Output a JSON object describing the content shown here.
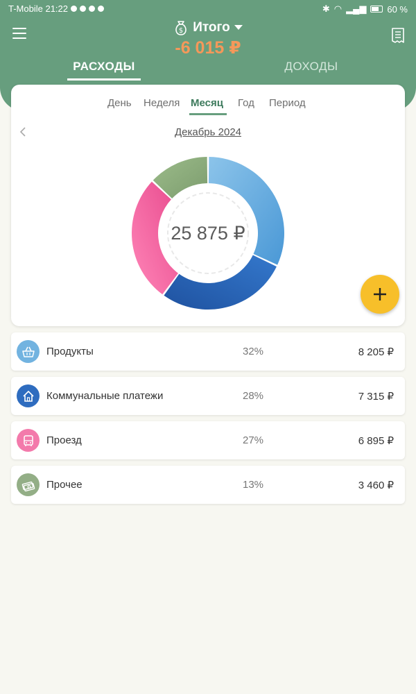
{
  "status": {
    "carrier_time": "T-Mobile 21:22",
    "battery": "60 %"
  },
  "header": {
    "title": "Итого",
    "total": "-6 015 ₽",
    "tabs": [
      {
        "label": "РАСХОДЫ",
        "active": true
      },
      {
        "label": "ДОХОДЫ",
        "active": false
      }
    ]
  },
  "period": {
    "tabs": [
      "День",
      "Неделя",
      "Месяц",
      "Год",
      "Период"
    ],
    "active": "Месяц",
    "label": "Декабрь 2024"
  },
  "donut": {
    "total": "25 875 ₽"
  },
  "chart_data": {
    "type": "pie",
    "categories": [
      "Продукты",
      "Коммунальные платежи",
      "Проезд",
      "Прочее"
    ],
    "values": [
      32,
      28,
      27,
      13
    ],
    "colors": [
      "#5aa6dc",
      "#2a66b8",
      "#f0609a",
      "#8aab7a"
    ]
  },
  "categories": [
    {
      "name": "Продукты",
      "pct": "32%",
      "amount": "8 205 ₽",
      "icon": "grocery-basket-icon",
      "color": "#72b3e0"
    },
    {
      "name": "Коммунальные платежи",
      "pct": "28%",
      "amount": "7 315 ₽",
      "icon": "house-icon",
      "color": "#2e6cbf"
    },
    {
      "name": "Проезд",
      "pct": "27%",
      "amount": "6 895 ₽",
      "icon": "bus-icon",
      "color": "#f37aab"
    },
    {
      "name": "Прочее",
      "pct": "13%",
      "amount": "3 460 ₽",
      "icon": "money-stack-icon",
      "color": "#93ae86"
    }
  ],
  "colors": {
    "header": "#679e7e",
    "total": "#f5985a",
    "fab": "#f7bf2a"
  }
}
